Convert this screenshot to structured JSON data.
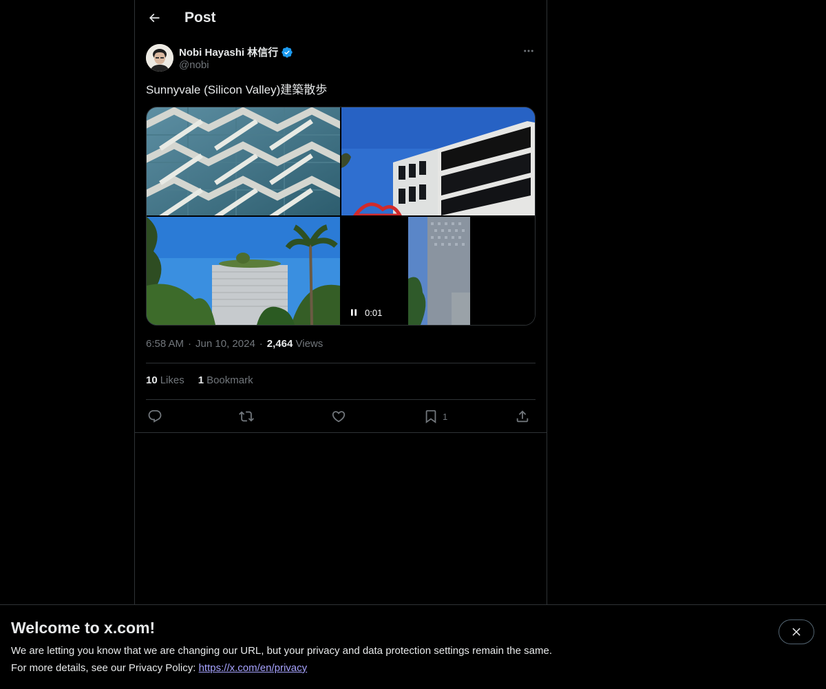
{
  "header": {
    "title": "Post",
    "back_icon": "arrow-left-icon"
  },
  "post": {
    "author": {
      "display_name": "Nobi Hayashi 林信行",
      "handle": "@nobi",
      "verified": true,
      "avatar_icon": "user-avatar"
    },
    "text": "Sunnyvale (Silicon Valley)建築散歩",
    "media": [
      {
        "type": "photo",
        "description": "building-lattice-facade"
      },
      {
        "type": "photo",
        "description": "office-building-blue-sky"
      },
      {
        "type": "photo",
        "description": "green-roof-building-palms"
      },
      {
        "type": "video",
        "time": "0:01",
        "state_icon": "pause-icon"
      }
    ],
    "time": "6:58 AM",
    "separator": "·",
    "date": "Jun 10, 2024",
    "views_count": "2,464",
    "views_label": "Views",
    "stats": {
      "likes_count": "10",
      "likes_label": "Likes",
      "bookmarks_count": "1",
      "bookmarks_label": "Bookmark"
    },
    "actions": {
      "reply_icon": "reply-icon",
      "repost_icon": "repost-icon",
      "like_icon": "heart-icon",
      "bookmark_icon": "bookmark-icon",
      "bookmark_count": "1",
      "share_icon": "share-icon"
    }
  },
  "banner": {
    "title": "Welcome to x.com!",
    "line1": "We are letting you know that we are changing our URL, but your privacy and data protection settings remain the same.",
    "line2_prefix": "For more details, see our Privacy Policy: ",
    "link": "https://x.com/en/privacy",
    "close_icon": "close-icon"
  },
  "colors": {
    "background": "#000000",
    "text": "#e7e9ea",
    "secondary_text": "#71767b",
    "border": "#2f3336",
    "verified_blue": "#1d9bf0",
    "link": "#a7a3ff"
  }
}
